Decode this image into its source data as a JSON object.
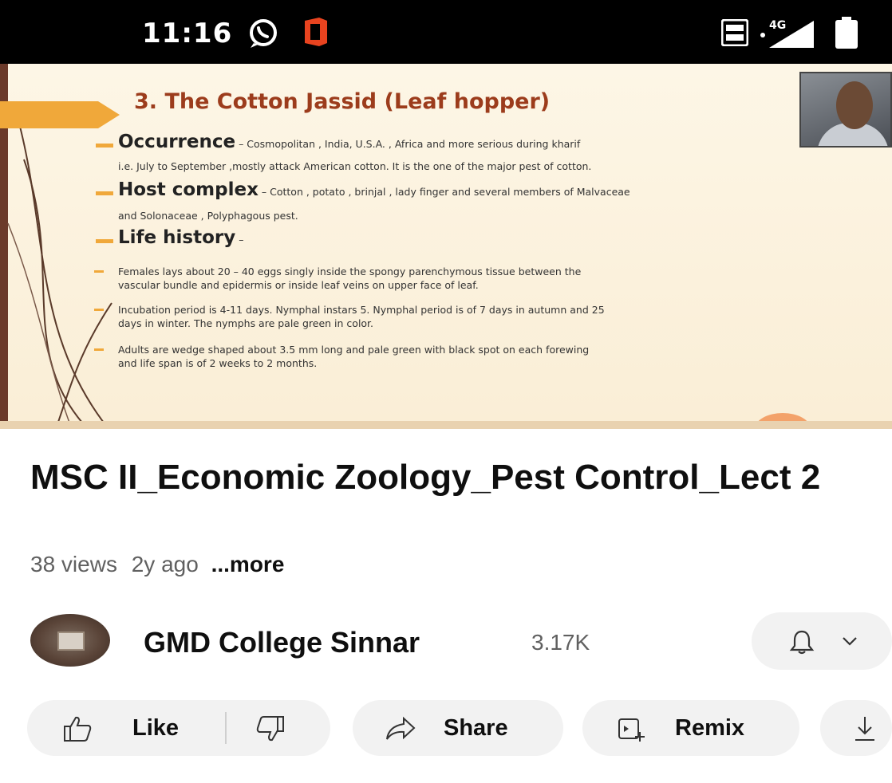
{
  "status_bar": {
    "time": "11:16",
    "icons": [
      "whatsapp-icon",
      "office-icon",
      "volte-icon",
      "signal-4g-icon",
      "battery-icon"
    ]
  },
  "slide": {
    "title": "3. The Cotton Jassid (Leaf hopper)",
    "sections": [
      {
        "head": "Occurrence",
        "text": " – Cosmopolitan , India, U.S.A. , Africa and more serious during kharif"
      },
      {
        "head": "",
        "text": "i.e. July to September ,mostly attack American cotton. It is the one of the major pest of cotton."
      },
      {
        "head": "Host complex",
        "text": " – Cotton , potato , brinjal , lady finger and several members of Malvaceae"
      },
      {
        "head": "",
        "text": "and Solonaceae , Polyphagous pest."
      },
      {
        "head": "Life history",
        "text": " –"
      }
    ],
    "bullets": [
      {
        "line1": "Females lays about 20 – 40 eggs singly inside the spongy parenchymous tissue between the",
        "line2": "vascular bundle and epidermis or inside leaf veins on upper face of leaf."
      },
      {
        "line1": "Incubation period is 4-11 days. Nymphal instars 5. Nymphal period is of 7 days in autumn and 25",
        "line2": "days in winter. The nymphs are pale green in color."
      },
      {
        "line1": "Adults are wedge shaped about 3.5 mm long and pale green with black spot on each forewing",
        "line2": "and life span is of 2 weeks to 2 months."
      }
    ]
  },
  "video": {
    "title": "MSC II_Economic Zoology_Pest Control_Lect 2",
    "views": "38 views",
    "age": "2y ago",
    "more": "...more"
  },
  "channel": {
    "name": "GMD College Sinnar",
    "subscribers": "3.17K"
  },
  "actions": {
    "like": "Like",
    "share": "Share",
    "remix": "Remix"
  },
  "colors": {
    "accent": "#f0a83a",
    "slide_title": "#9c3c1c",
    "pill_bg": "#f2f2f2"
  }
}
